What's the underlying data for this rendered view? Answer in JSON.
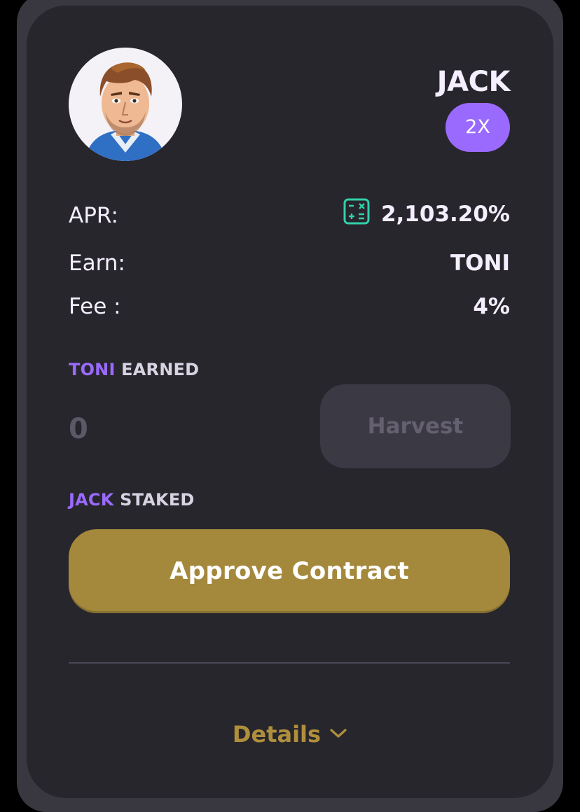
{
  "farm": {
    "name": "JACK",
    "multiplier": "2X"
  },
  "stats": {
    "apr_label": "APR:",
    "apr_value": "2,103.20%",
    "earn_label": "Earn:",
    "earn_value": "TONI",
    "fee_label": "Fee :",
    "fee_value": "4%"
  },
  "earned": {
    "token": "TONI",
    "label": "EARNED",
    "amount": "0",
    "harvest_label": "Harvest"
  },
  "staked": {
    "token": "JACK",
    "label": "STAKED",
    "approve_label": "Approve Contract"
  },
  "footer": {
    "details_label": "Details"
  },
  "icons": {
    "avatar": "avatar-icon",
    "calculator": "calculator-icon",
    "chevron": "chevron-down-icon"
  },
  "colors": {
    "accent_purple": "#9a6aff",
    "gold": "#a4883c",
    "card_bg": "#27262c"
  }
}
